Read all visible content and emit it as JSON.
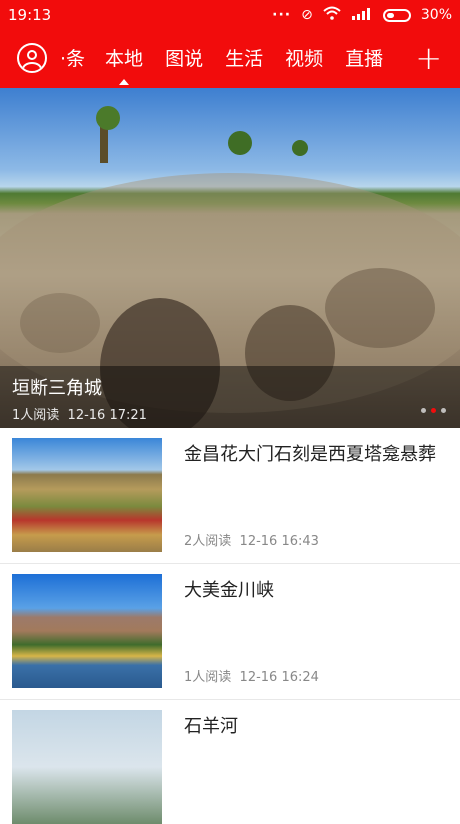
{
  "status_bar": {
    "time": "19:13",
    "network": "4G",
    "battery": "30%"
  },
  "nav": {
    "tabs": [
      {
        "label": "头条",
        "shown": "·条"
      },
      {
        "label": "本地"
      },
      {
        "label": "图说"
      },
      {
        "label": "生活"
      },
      {
        "label": "视频"
      },
      {
        "label": "直播"
      }
    ],
    "active_tab": "本地",
    "plus": "+"
  },
  "hero": {
    "title": "垣断三角城",
    "reads": "1人阅读",
    "time": "12-16 17:21",
    "pages": 3,
    "current_page": 2
  },
  "articles": [
    {
      "title": "金昌花大门石刻是西夏塔龛悬葬",
      "reads": "2人阅读",
      "time": "12-16 16:43"
    },
    {
      "title": "大美金川峡",
      "reads": "1人阅读",
      "time": "12-16 16:24"
    },
    {
      "title": "石羊河"
    }
  ],
  "colors": {
    "brand": "#f20c0c"
  }
}
